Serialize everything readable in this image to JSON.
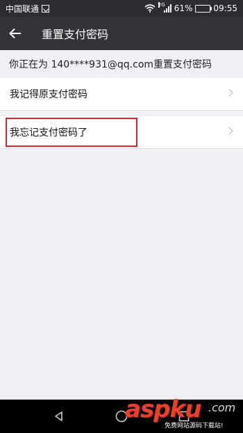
{
  "status_bar": {
    "carrier": "中国联通",
    "network_tag": "2G",
    "battery": "61%",
    "battery_level": 0.61,
    "time": "09:55",
    "icons": [
      "sim-icon",
      "wifi-icon",
      "signal-icon",
      "battery-icon"
    ]
  },
  "app_bar": {
    "title": "重置支付密码",
    "back_icon": "arrow-left-icon"
  },
  "hint": "你正在为 140****931@qq.com重置支付密码",
  "menu": {
    "items": [
      {
        "label": "我记得原支付密码"
      },
      {
        "label": "我忘记支付密码了"
      }
    ]
  },
  "highlight_color": "#d9242d",
  "watermark": {
    "brand": "aspku",
    "suffix": ".com",
    "tagline": "免费网站源码下载站!"
  }
}
